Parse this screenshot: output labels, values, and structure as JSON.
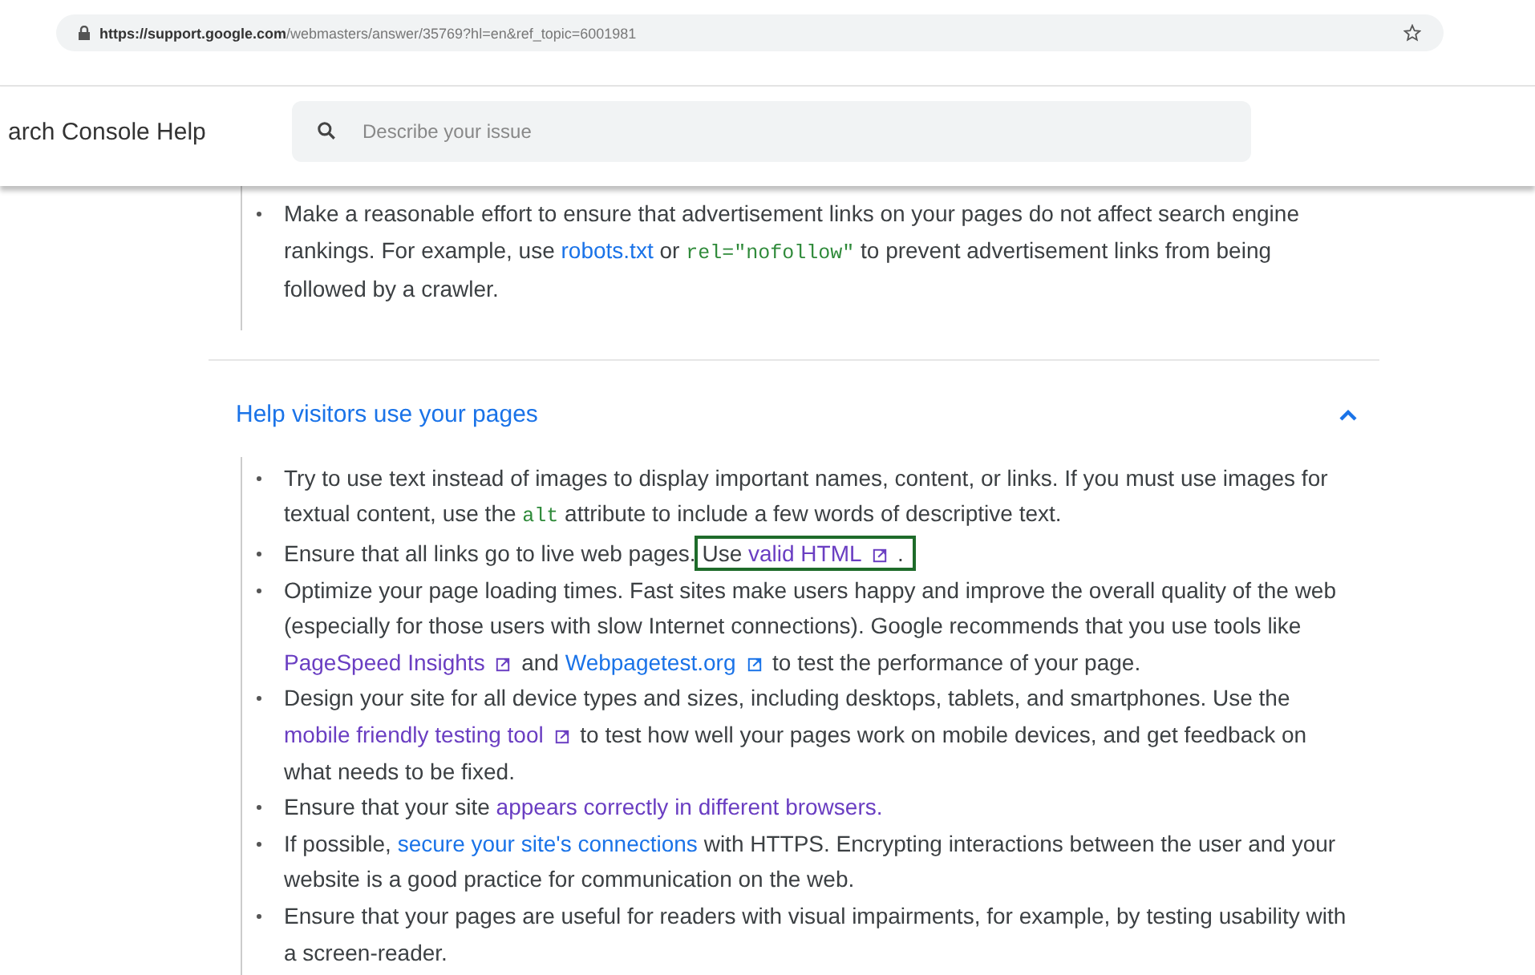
{
  "browser": {
    "url_host": "https://support.google.com",
    "url_path": "/webmasters/answer/35769?hl=en&ref_topic=6001981"
  },
  "header": {
    "title": "arch Console Help",
    "search": {
      "placeholder": "Describe your issue"
    }
  },
  "sections": [
    {
      "items": [
        [
          {
            "kind": "text",
            "text": "Make a reasonable effort to ensure that advertisement links on your pages do not affect search engine rankings. For example, use "
          },
          {
            "kind": "link",
            "text": "robots.txt",
            "visited": false,
            "external": false
          },
          {
            "kind": "text",
            "text": " or "
          },
          {
            "kind": "code",
            "text": "rel=\"nofollow\""
          },
          {
            "kind": "text",
            "text": " to prevent advertisement links from being followed by a crawler."
          }
        ]
      ]
    },
    {
      "title": "Help visitors use your pages",
      "expanded": true,
      "items": [
        [
          {
            "kind": "text",
            "text": "Try to use text instead of images to display important names, content, or links. If you must use images for textual content, use the "
          },
          {
            "kind": "code",
            "text": "alt"
          },
          {
            "kind": "text",
            "text": " attribute to include a few words of descriptive text."
          }
        ],
        [
          {
            "kind": "text",
            "text": "Ensure that all links go to live web pages. "
          },
          {
            "kind": "text",
            "text": "Use ",
            "highlighted": true
          },
          {
            "kind": "link",
            "text": "valid HTML",
            "visited": true,
            "external": true,
            "highlighted": true
          },
          {
            "kind": "text",
            "text": " .",
            "highlighted": true
          }
        ],
        [
          {
            "kind": "text",
            "text": "Optimize your page loading times. Fast sites make users happy and improve the overall quality of the web (especially for those users with slow Internet connections). Google recommends that you use tools like "
          },
          {
            "kind": "link",
            "text": "PageSpeed Insights",
            "visited": true,
            "external": true
          },
          {
            "kind": "text",
            "text": " and "
          },
          {
            "kind": "link",
            "text": "Webpagetest.org",
            "visited": false,
            "external": true
          },
          {
            "kind": "text",
            "text": " to test the performance of your page."
          }
        ],
        [
          {
            "kind": "text",
            "text": "Design your site for all device types and sizes, including desktops, tablets, and smartphones. Use the "
          },
          {
            "kind": "link",
            "text": "mobile friendly testing tool",
            "visited": true,
            "external": true
          },
          {
            "kind": "text",
            "text": " to test how well your pages work on mobile devices, and get feedback on what needs to be fixed."
          }
        ],
        [
          {
            "kind": "text",
            "text": "Ensure that your site "
          },
          {
            "kind": "link",
            "text": "appears correctly in different browsers.",
            "visited": true,
            "external": false
          }
        ],
        [
          {
            "kind": "text",
            "text": "If possible, "
          },
          {
            "kind": "link",
            "text": "secure your site's connections",
            "visited": false,
            "external": false
          },
          {
            "kind": "text",
            "text": " with HTTPS. Encrypting interactions between the user and your website is a good practice for communication on the web."
          }
        ],
        [
          {
            "kind": "text",
            "text": "Ensure that your pages are useful for readers with visual impairments, for example, by testing usability with a screen-reader."
          }
        ]
      ]
    }
  ]
}
